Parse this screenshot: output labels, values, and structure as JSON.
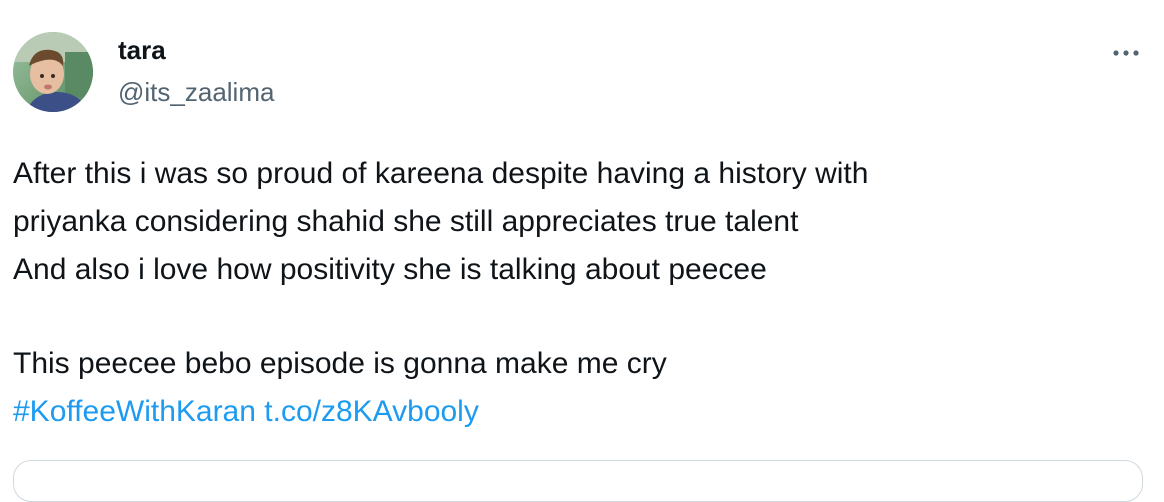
{
  "author": {
    "display_name": "tara",
    "handle": "@its_zaalima",
    "avatar_icon": "child-photo-avatar"
  },
  "more_icon": "more-horizontal-icon",
  "tweet": {
    "lines": [
      "After this i was so proud of kareena despite having a history with",
      "priyanka considering shahid she still appreciates true talent",
      "And also i love how positivity she is talking about peecee",
      "This peecee bebo episode is gonna make me cry"
    ],
    "hashtag": "#KoffeeWithKaran",
    "link": "t.co/z8KAvbooly"
  },
  "colors": {
    "text": "#0f1419",
    "secondary": "#536471",
    "link": "#1d9bf0",
    "border": "#cfd9de"
  }
}
